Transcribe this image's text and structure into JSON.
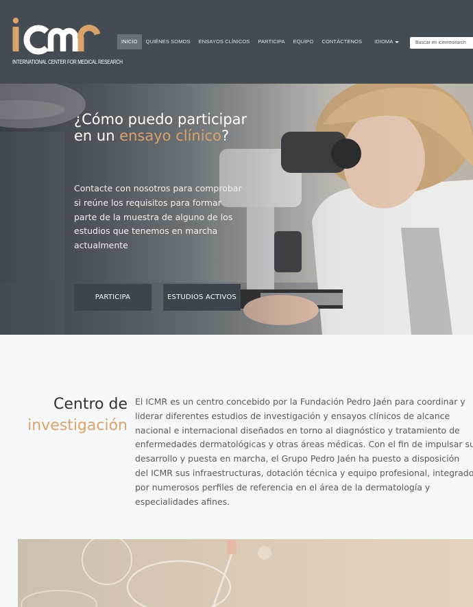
{
  "header": {
    "logo_text": "icmr",
    "logo_subtitle": "INTERNATIONAL CENTER FOR MEDICAL RESEARCH",
    "nav": [
      {
        "label": "INICIO",
        "active": true
      },
      {
        "label": "QUIÉNES SOMOS"
      },
      {
        "label": "ENSAYOS CLÍNICOS"
      },
      {
        "label": "PARTICIPA"
      },
      {
        "label": "EQUIPO"
      },
      {
        "label": "CONTÁCTENOS"
      }
    ],
    "language_label": "IDIOMA",
    "search_placeholder": "Buscar en icmrresearch"
  },
  "hero": {
    "title_part1": "¿Cómo puedo participar en un ",
    "title_accent": "ensayo clínico",
    "title_part2": "?",
    "text": "Contacte con nosotros para comprobar si reúne los requisitos para formar parte de la muestra de alguno de los estudios que tenemos en marcha actualmente",
    "button1": "PARTICIPA",
    "button2": "ESTUDIOS ACTIVOS"
  },
  "intro": {
    "title_line1": "Centro de",
    "title_line2": "investigación",
    "lines": [
      "El ICMR es un centro concebido por la Fundación Pedro Jaén para coordinar y",
      "liderar diferentes estudios de investigación y ensayos clínicos de alcance",
      "nacional e internacional diseñados en torno al diagnóstico y tratamiento de",
      "enfermedades dermatológicas y otras áreas médicas. Con el fin de impulsar su",
      "desarrollo y puesta en marcha, el Grupo Pedro Jaén ha puesto a disposición",
      "del ICMR sus infraestructuras, dotación técnica y equipo profesional, integrado",
      "por numerosos perfiles de referencia en el área de la dermatología y",
      "especialidades afines."
    ]
  },
  "colors": {
    "header_bg": "#454b53",
    "accent": "#d9a46b",
    "button_bg": "#3e444c",
    "page_bg": "#f6f7f9"
  }
}
